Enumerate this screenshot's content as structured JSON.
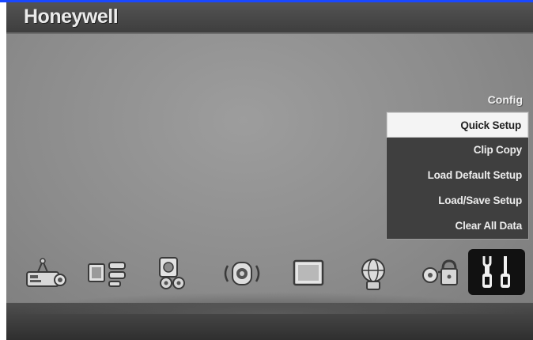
{
  "brand": "Honeywell",
  "menu": {
    "title": "Config",
    "items": [
      {
        "label": "Quick Setup",
        "selected": true
      },
      {
        "label": "Clip Copy",
        "selected": false
      },
      {
        "label": "Load Default Setup",
        "selected": false
      },
      {
        "label": "Load/Save Setup",
        "selected": false
      },
      {
        "label": "Clear All Data",
        "selected": false
      }
    ]
  },
  "icons": [
    {
      "name": "device-setup-icon"
    },
    {
      "name": "camera-display-icon"
    },
    {
      "name": "storage-disk-icon"
    },
    {
      "name": "audio-alarm-icon"
    },
    {
      "name": "monitor-icon"
    },
    {
      "name": "network-globe-icon"
    },
    {
      "name": "security-lock-icon"
    },
    {
      "name": "config-tools-icon",
      "active": true
    }
  ],
  "colors": {
    "header": "#444444",
    "background": "#8e8e8e",
    "menu_bg": "#3f3f3f",
    "selected_bg": "#f4f4f4",
    "active_icon_bg": "#111111",
    "accent_line": "#1a48ff"
  }
}
